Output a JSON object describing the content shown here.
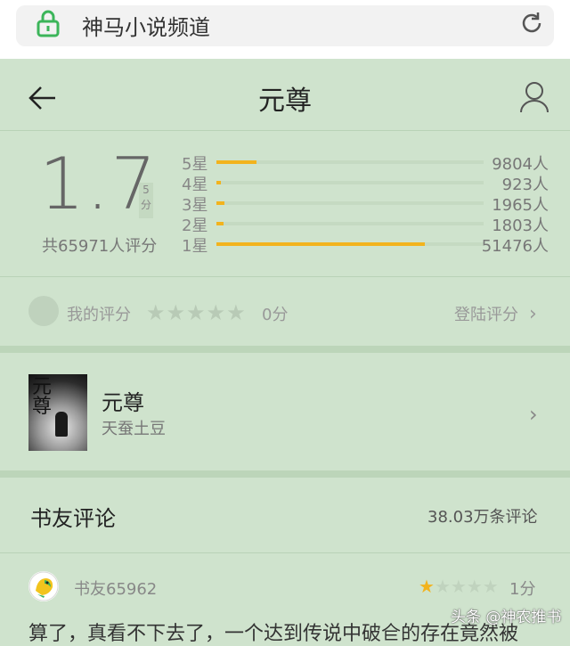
{
  "browser": {
    "url_title": "神马小说频道"
  },
  "header": {
    "title": "元尊"
  },
  "rating": {
    "score": "1.7",
    "max_label": "5分",
    "total": "共65971人评分",
    "rows": [
      {
        "label": "5星",
        "count": "9804人",
        "fraction": 0.149
      },
      {
        "label": "4星",
        "count": "923人",
        "fraction": 0.014
      },
      {
        "label": "3星",
        "count": "1965人",
        "fraction": 0.03
      },
      {
        "label": "2星",
        "count": "1803人",
        "fraction": 0.027
      },
      {
        "label": "1星",
        "count": "51476人",
        "fraction": 0.78
      }
    ]
  },
  "my_rating": {
    "label": "我的评分",
    "stars": "★★★★★",
    "score": "0分",
    "login": "登陆评分"
  },
  "book": {
    "cover_title": "元尊",
    "name": "元尊",
    "author": "天蚕土豆"
  },
  "reviews": {
    "title": "书友评论",
    "count": "38.03万条评论",
    "items": [
      {
        "user": "书友65962",
        "stars_on": "★",
        "stars_off": "★★★★",
        "score": "1分",
        "text": "算了，真看不下去了，一个达到传说中破仺的存在竟然被"
      }
    ]
  },
  "watermark": "头条 @神农推书",
  "colors": {
    "accent": "#f2b31d",
    "background": "#cfe3cd",
    "lock_green": "#3cb55a"
  },
  "icons": [
    "lock-icon",
    "refresh-icon",
    "back-arrow-icon",
    "user-icon",
    "chevron-right-icon",
    "star-icon"
  ]
}
